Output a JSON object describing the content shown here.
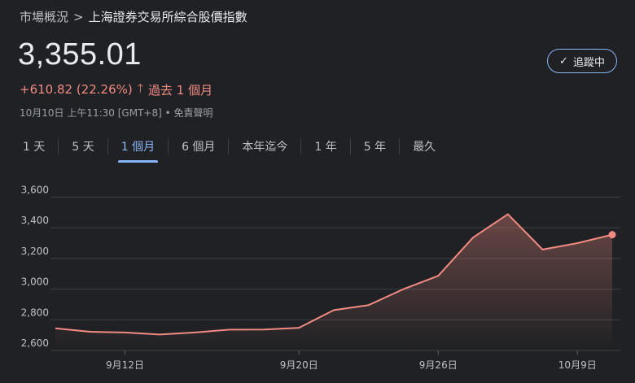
{
  "breadcrumb": {
    "parent": "市場概況",
    "separator": ">",
    "current": "上海證券交易所綜合股價指數"
  },
  "price": "3,355.01",
  "change": {
    "value": "+610.82 (22.26%)",
    "arrow_icon": "arrow-up-icon",
    "period": "過去 1 個月"
  },
  "meta": {
    "timestamp": "10月10日 上午11:30 [GMT+8]",
    "bullet": "•",
    "disclaimer": "免責聲明"
  },
  "follow_button": {
    "label": "追蹤中",
    "icon": "check-icon"
  },
  "tabs": [
    {
      "label": "1 天"
    },
    {
      "label": "5 天"
    },
    {
      "label": "1 個月",
      "active": true
    },
    {
      "label": "6 個月"
    },
    {
      "label": "本年迄今"
    },
    {
      "label": "1 年"
    },
    {
      "label": "5 年"
    },
    {
      "label": "最久"
    }
  ],
  "colors": {
    "line": "#f28b82",
    "accent": "#8ab4f8",
    "background": "#202124"
  },
  "chart_data": {
    "type": "area",
    "x": [
      "9月10日",
      "9月11日",
      "9月12日",
      "9月13日",
      "9月16日",
      "9月18日",
      "9月19日",
      "9月20日",
      "9月23日",
      "9月24日",
      "9月25日",
      "9月26日",
      "9月27日",
      "9月30日",
      "10月8日",
      "10月9日",
      "10月10日"
    ],
    "values": [
      2744,
      2722,
      2717,
      2704,
      2717,
      2736,
      2737,
      2748,
      2863,
      2896,
      3000,
      3087,
      3336,
      3489,
      3258,
      3300,
      3355
    ],
    "xtick_labels": [
      "9月12日",
      "9月20日",
      "9月26日",
      "10月9日"
    ],
    "ytick_labels": [
      "3,600",
      "3,400",
      "3,200",
      "3,000",
      "2,800",
      "2,600"
    ],
    "ylim": [
      2600,
      3650
    ],
    "grid": true
  }
}
